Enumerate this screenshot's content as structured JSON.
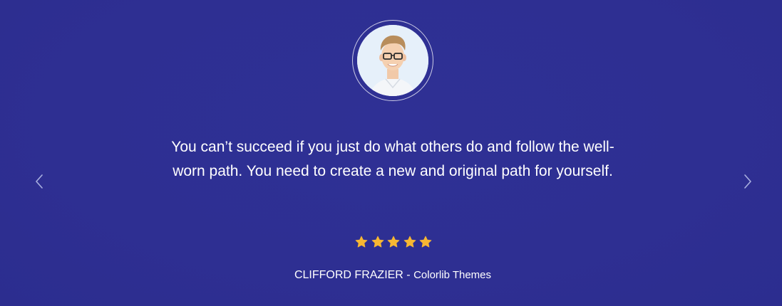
{
  "testimonial": {
    "quote": "You can’t succeed if you just do what others do and follow the well-worn path. You need to create a new and original path for yourself.",
    "rating": 5,
    "rating_max": 5,
    "author_name": "CLIFFORD FRAZIER",
    "separator": " - ",
    "author_company": "Colorlib Themes",
    "avatar": "avatar-photo"
  },
  "navigation": {
    "prev_icon": "chevron-left-icon",
    "next_icon": "chevron-right-icon"
  },
  "colors": {
    "background": "#2f2f94",
    "star": "#f7b733",
    "text": "#ffffff"
  }
}
